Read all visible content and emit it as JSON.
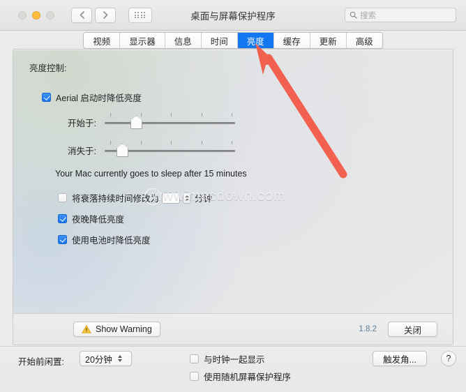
{
  "window": {
    "title": "桌面与屏幕保护程序",
    "traffic_lights": [
      "close",
      "minimize",
      "zoom"
    ],
    "nav": {
      "back": "‹",
      "forward": "›"
    },
    "grid_button": "show-all-grid"
  },
  "search": {
    "placeholder": "搜索",
    "value": "",
    "icon": "search-icon"
  },
  "tabs": [
    {
      "label": "视频",
      "active": false
    },
    {
      "label": "显示器",
      "active": false
    },
    {
      "label": "信息",
      "active": false
    },
    {
      "label": "时间",
      "active": false
    },
    {
      "label": "亮度",
      "active": true
    },
    {
      "label": "缓存",
      "active": false
    },
    {
      "label": "更新",
      "active": false
    },
    {
      "label": "高级",
      "active": false
    }
  ],
  "pane": {
    "section_title": "亮度控制:",
    "dim_on_start": {
      "label": "Aerial 启动时降低亮度",
      "checked": true
    },
    "sliders": [
      {
        "label": "开始于:",
        "value_percent": 24,
        "ticks": 5
      },
      {
        "label": "消失于:",
        "value_percent": 13,
        "ticks": 5
      }
    ],
    "sleep_note": "Your Mac currently goes to sleep after 15 minutes",
    "fade_duration": {
      "label_before": "将衰落持续时间修改为",
      "value": "",
      "label_after": "分钟",
      "checked": false
    },
    "dim_at_night": {
      "label": "夜晚降低亮度",
      "checked": true
    },
    "dim_on_battery": {
      "label": "使用电池时降低亮度",
      "checked": true
    },
    "footer": {
      "warning_button": "Show Warning",
      "warning_icon": "warning-triangle-icon",
      "version": "1.8.2",
      "close_button": "关闭"
    }
  },
  "bottom": {
    "idle_label": "开始前闲置:",
    "idle_value": "20分钟",
    "show_with_clock": {
      "label": "与时钟一起显示",
      "checked": false
    },
    "use_random_saver": {
      "label": "使用随机屏幕保护程序",
      "checked": false
    },
    "hot_corners_button": "触发角...",
    "help_button": "?"
  },
  "watermark": {
    "text": "www.macdown.com"
  },
  "annotation": {
    "type": "arrow",
    "color": "#f2604f",
    "points_to": "亮度",
    "from": [
      495,
      252
    ],
    "to": [
      371,
      66
    ]
  },
  "colors": {
    "accent": "#1277f0",
    "checkbox_on": "#2b80ef",
    "annotation_red": "#f2604f",
    "version_text": "#5c7899",
    "warning_yellow": "#f6c540"
  }
}
